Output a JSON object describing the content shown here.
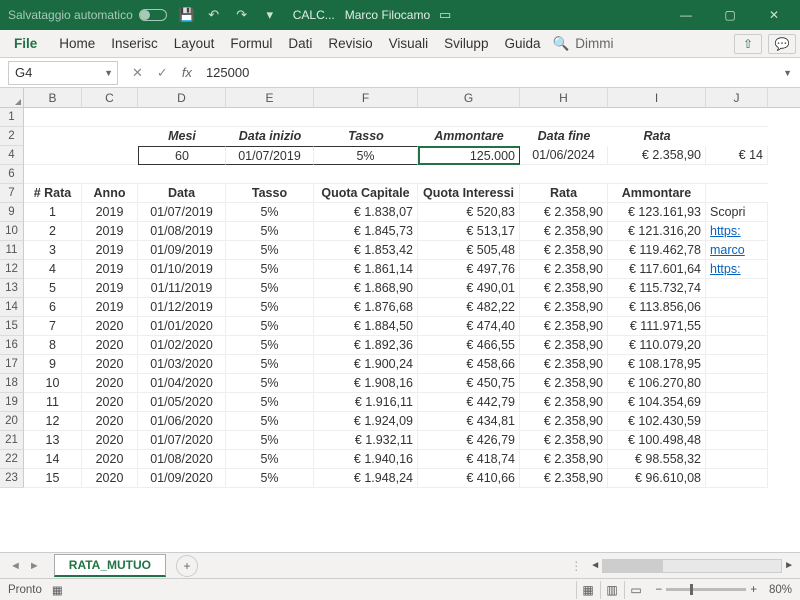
{
  "title": {
    "autosave": "Salvataggio automatico",
    "filename": "CALC...",
    "user": "Marco Filocamo"
  },
  "ribbon": {
    "file": "File",
    "home": "Home",
    "inserisci": "Inserisc",
    "layout": "Layout",
    "formule": "Formul",
    "dati": "Dati",
    "revisione": "Revisio",
    "visualizza": "Visuali",
    "sviluppo": "Svilupp",
    "guida": "Guida",
    "dimmi": "Dimmi"
  },
  "formula": {
    "ref": "G4",
    "value": "125000"
  },
  "cols": [
    "B",
    "C",
    "D",
    "E",
    "F",
    "G",
    "H",
    "I",
    "J"
  ],
  "params_labels": {
    "mesi": "Mesi",
    "data_inizio": "Data inizio",
    "tasso": "Tasso",
    "ammontare": "Ammontare",
    "data_fine": "Data fine",
    "rata": "Rata"
  },
  "params": {
    "mesi": "60",
    "data_inizio": "01/07/2019",
    "tasso": "5%",
    "ammontare": "125.000",
    "data_fine": "01/06/2024",
    "rata": "€ 2.358,90",
    "extra": "€ 14"
  },
  "table_headers": {
    "num": "# Rata",
    "anno": "Anno",
    "data": "Data",
    "tasso": "Tasso",
    "qc": "Quota Capitale",
    "qi": "Quota Interessi",
    "rata": "Rata",
    "amm": "Ammontare"
  },
  "side": {
    "scopri": "Scopri",
    "h1": "https:",
    "h2": "marco",
    "h3": "https:"
  },
  "rows": [
    {
      "n": "1",
      "a": "2019",
      "d": "01/07/2019",
      "t": "5%",
      "qc": "€ 1.838,07",
      "qi": "€ 520,83",
      "r": "€ 2.358,90",
      "am": "€ 123.161,93"
    },
    {
      "n": "2",
      "a": "2019",
      "d": "01/08/2019",
      "t": "5%",
      "qc": "€ 1.845,73",
      "qi": "€ 513,17",
      "r": "€ 2.358,90",
      "am": "€ 121.316,20"
    },
    {
      "n": "3",
      "a": "2019",
      "d": "01/09/2019",
      "t": "5%",
      "qc": "€ 1.853,42",
      "qi": "€ 505,48",
      "r": "€ 2.358,90",
      "am": "€ 119.462,78"
    },
    {
      "n": "4",
      "a": "2019",
      "d": "01/10/2019",
      "t": "5%",
      "qc": "€ 1.861,14",
      "qi": "€ 497,76",
      "r": "€ 2.358,90",
      "am": "€ 117.601,64"
    },
    {
      "n": "5",
      "a": "2019",
      "d": "01/11/2019",
      "t": "5%",
      "qc": "€ 1.868,90",
      "qi": "€ 490,01",
      "r": "€ 2.358,90",
      "am": "€ 115.732,74"
    },
    {
      "n": "6",
      "a": "2019",
      "d": "01/12/2019",
      "t": "5%",
      "qc": "€ 1.876,68",
      "qi": "€ 482,22",
      "r": "€ 2.358,90",
      "am": "€ 113.856,06"
    },
    {
      "n": "7",
      "a": "2020",
      "d": "01/01/2020",
      "t": "5%",
      "qc": "€ 1.884,50",
      "qi": "€ 474,40",
      "r": "€ 2.358,90",
      "am": "€ 111.971,55"
    },
    {
      "n": "8",
      "a": "2020",
      "d": "01/02/2020",
      "t": "5%",
      "qc": "€ 1.892,36",
      "qi": "€ 466,55",
      "r": "€ 2.358,90",
      "am": "€ 110.079,20"
    },
    {
      "n": "9",
      "a": "2020",
      "d": "01/03/2020",
      "t": "5%",
      "qc": "€ 1.900,24",
      "qi": "€ 458,66",
      "r": "€ 2.358,90",
      "am": "€ 108.178,95"
    },
    {
      "n": "10",
      "a": "2020",
      "d": "01/04/2020",
      "t": "5%",
      "qc": "€ 1.908,16",
      "qi": "€ 450,75",
      "r": "€ 2.358,90",
      "am": "€ 106.270,80"
    },
    {
      "n": "11",
      "a": "2020",
      "d": "01/05/2020",
      "t": "5%",
      "qc": "€ 1.916,11",
      "qi": "€ 442,79",
      "r": "€ 2.358,90",
      "am": "€ 104.354,69"
    },
    {
      "n": "12",
      "a": "2020",
      "d": "01/06/2020",
      "t": "5%",
      "qc": "€ 1.924,09",
      "qi": "€ 434,81",
      "r": "€ 2.358,90",
      "am": "€ 102.430,59"
    },
    {
      "n": "13",
      "a": "2020",
      "d": "01/07/2020",
      "t": "5%",
      "qc": "€ 1.932,11",
      "qi": "€ 426,79",
      "r": "€ 2.358,90",
      "am": "€ 100.498,48"
    },
    {
      "n": "14",
      "a": "2020",
      "d": "01/08/2020",
      "t": "5%",
      "qc": "€ 1.940,16",
      "qi": "€ 418,74",
      "r": "€ 2.358,90",
      "am": "€ 98.558,32"
    },
    {
      "n": "15",
      "a": "2020",
      "d": "01/09/2020",
      "t": "5%",
      "qc": "€ 1.948,24",
      "qi": "€ 410,66",
      "r": "€ 2.358,90",
      "am": "€ 96.610,08"
    }
  ],
  "row_numbers_pre": [
    "1",
    "2",
    "4",
    "6",
    "7"
  ],
  "sheet_tab": "RATA_MUTUO",
  "status": {
    "ready": "Pronto",
    "zoom": "80%"
  }
}
